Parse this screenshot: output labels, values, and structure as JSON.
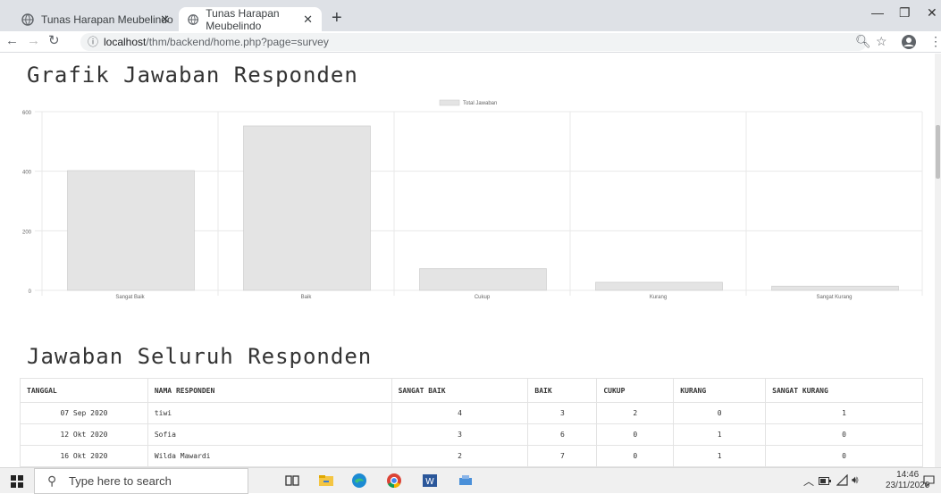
{
  "browser": {
    "tabs": [
      {
        "title": "Tunas Harapan Meubelindo",
        "active": false
      },
      {
        "title": "Tunas Harapan Meubelindo",
        "active": true
      }
    ],
    "new_tab_symbol": "+",
    "url_host": "localhost",
    "url_path": "/thm/backend/home.php?page=survey"
  },
  "page": {
    "chart_title": "Grafik Jawaban Responden",
    "table_title": "Jawaban Seluruh Responden"
  },
  "chart_data": {
    "type": "bar",
    "legend": "Total Jawaban",
    "legend_position": "top",
    "categories": [
      "Sangat Baik",
      "Baik",
      "Cukup",
      "Kurang",
      "Sangat Kurang"
    ],
    "values": [
      402,
      552,
      73,
      27,
      14
    ],
    "y_ticks": [
      0,
      200,
      400,
      600
    ],
    "ylim": [
      0,
      600
    ],
    "grid": true,
    "bar_color": "#e4e4e4"
  },
  "table": {
    "columns": [
      "TANGGAL",
      "NAMA RESPONDEN",
      "SANGAT BAIK",
      "BAIK",
      "CUKUP",
      "KURANG",
      "SANGAT KURANG"
    ],
    "rows": [
      [
        "07 Sep 2020",
        "tiwi",
        "4",
        "3",
        "2",
        "0",
        "1"
      ],
      [
        "12 Okt 2020",
        "Sofia",
        "3",
        "6",
        "0",
        "1",
        "0"
      ],
      [
        "16 Okt 2020",
        "Wilda Mawardi",
        "2",
        "7",
        "0",
        "1",
        "0"
      ]
    ]
  },
  "taskbar": {
    "search_placeholder": "Type here to search",
    "time": "14:46",
    "date": "23/11/2020"
  }
}
